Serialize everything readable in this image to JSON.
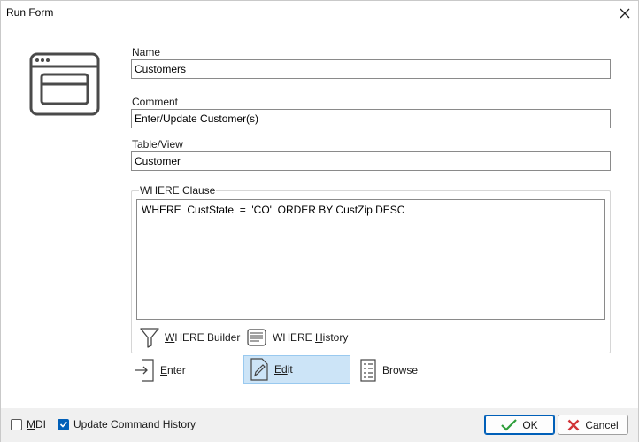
{
  "window": {
    "title": "Run Form"
  },
  "fields": {
    "name_label": "Name",
    "name_value": "Customers",
    "comment_label": "Comment",
    "comment_value": "Enter/Update Customer(s)",
    "table_label": "Table/View",
    "table_value": "Customer"
  },
  "where": {
    "legend": "WHERE Clause",
    "value": "WHERE  CustState  =  'CO'  ORDER BY CustZip DESC",
    "builder_prefix": "W",
    "builder_rest": "HERE Builder",
    "history_prefix": "WHERE ",
    "history_mid": "H",
    "history_rest": "istory"
  },
  "modes": {
    "enter_u": "E",
    "enter_rest": "nter",
    "edit_u": "E",
    "edit_d": "d",
    "edit_rest": "it",
    "browse_label": "Browse",
    "active": "edit"
  },
  "footer": {
    "mdi_u": "M",
    "mdi_rest": "DI",
    "mdi_checked": false,
    "history_label": "Update Command History",
    "history_checked": true,
    "ok_u": "O",
    "ok_rest": "K",
    "cancel_u": "C",
    "cancel_rest": "ancel"
  },
  "colors": {
    "accent": "#005fb8",
    "active_bg": "#cce4f7",
    "ok_check": "#2e9e3a",
    "cancel_x": "#d13438"
  }
}
